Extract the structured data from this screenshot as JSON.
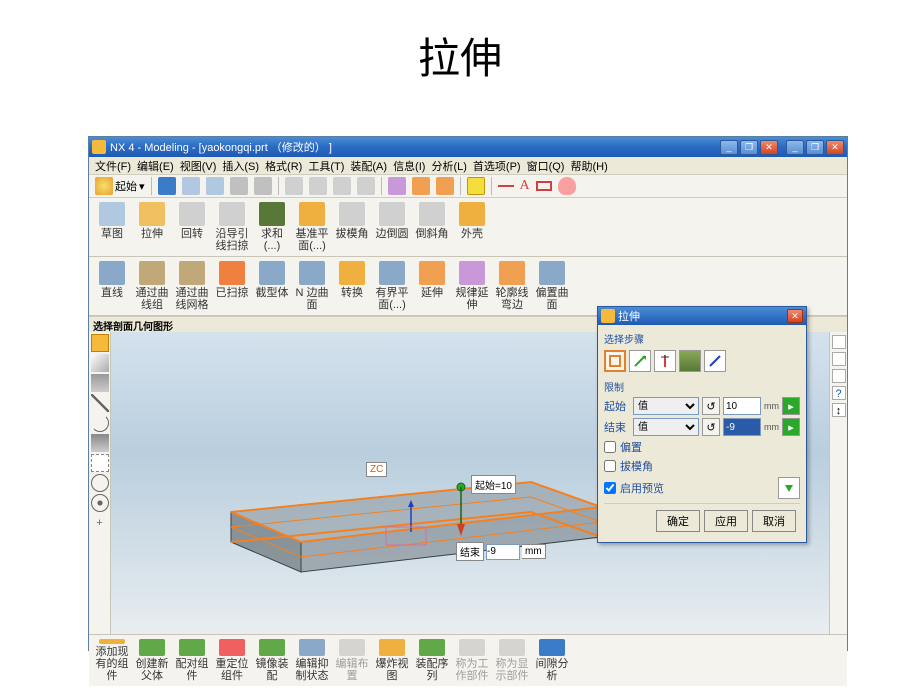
{
  "slide_title": "拉伸",
  "titlebar": {
    "text": "NX 4 - Modeling - [yaokongqi.prt （修改的） ]"
  },
  "winbuttons": {
    "min": "_",
    "restore": "❐",
    "close": "✕",
    "min2": "_",
    "restore2": "❐",
    "close2": "✕"
  },
  "menus": [
    "文件(F)",
    "编辑(E)",
    "视图(V)",
    "插入(S)",
    "格式(R)",
    "工具(T)",
    "装配(A)",
    "信息(I)",
    "分析(L)",
    "首选项(P)",
    "窗口(Q)",
    "帮助(H)"
  ],
  "dropdown1": {
    "label": "起始",
    "arrow": "▾"
  },
  "toolbar_icons": {
    "colors": [
      "#3a7cc8",
      "#3a7cc8",
      "#d0d0d0",
      "#d0d0d0",
      "#d0d0d0",
      "#d0d0d0"
    ]
  },
  "ribbon1": [
    {
      "label": "草图",
      "c": "#b0c8e0"
    },
    {
      "label": "拉伸",
      "c": "#f0c060"
    },
    {
      "label": "回转",
      "c": "#d0d0d0"
    },
    {
      "label": "沿导引线扫掠",
      "c": "#d0d0d0"
    },
    {
      "label": "求和(...)",
      "c": "#587838"
    },
    {
      "label": "基准平面(...)",
      "c": "#f0b040"
    },
    {
      "label": "拔模角",
      "c": "#d0d0d0"
    },
    {
      "label": "边倒圆",
      "c": "#d0d0d0"
    },
    {
      "label": "倒斜角",
      "c": "#d0d0d0"
    },
    {
      "label": "外壳",
      "c": "#f0b040"
    }
  ],
  "ribbon2": [
    {
      "label": "直线",
      "c": "#8aa8c8"
    },
    {
      "label": "通过曲线组",
      "c": "#c0a878"
    },
    {
      "label": "通过曲线网格",
      "c": "#c0a878"
    },
    {
      "label": "已扫掠",
      "c": "#f08040"
    },
    {
      "label": "截型体",
      "c": "#8aa8c8"
    },
    {
      "label": "N 边曲面",
      "c": "#8aa8c8"
    },
    {
      "label": "转换",
      "c": "#f0b040"
    },
    {
      "label": "有界平面(...)",
      "c": "#8aa8c8"
    },
    {
      "label": "延伸",
      "c": "#f0a050"
    },
    {
      "label": "规律延伸",
      "c": "#c898d8"
    },
    {
      "label": "轮廓线弯边",
      "c": "#f0a050"
    },
    {
      "label": "偏置曲面",
      "c": "#8aa8c8"
    }
  ],
  "status": "选择剖面几何图形",
  "dialog": {
    "title": "拉伸",
    "group1": "选择步骤",
    "group2": "限制",
    "start_label": "起始",
    "end_label": "结束",
    "value_opt": "值",
    "start_val": "10",
    "end_val": "-9",
    "unit": "mm",
    "offset": "偏置",
    "draft": "拔模角",
    "preview": "启用预览",
    "ok": "确定",
    "apply": "应用",
    "cancel": "取消"
  },
  "annotations": {
    "zc": "ZC",
    "start": "起始=10",
    "end_label": "结束",
    "end_val": "-9",
    "end_unit": "mm"
  },
  "bottom": [
    {
      "label": "添加现有的组件",
      "c": "#f0b040"
    },
    {
      "label": "创建新父体",
      "c": "#60a848"
    },
    {
      "label": "配对组件",
      "c": "#60a848"
    },
    {
      "label": "重定位组件",
      "c": "#f06060"
    },
    {
      "label": "镜像装配",
      "c": "#60a848"
    },
    {
      "label": "编辑抑制状态",
      "c": "#8aa8c8"
    },
    {
      "label": "编辑布置",
      "c": "#b0b0b0",
      "disabled": true
    },
    {
      "label": "爆炸视图",
      "c": "#f0b040"
    },
    {
      "label": "装配序列",
      "c": "#60a848"
    },
    {
      "label": "称为工作部件",
      "c": "#b0b0b0",
      "disabled": true
    },
    {
      "label": "称为显示部件",
      "c": "#b0b0b0",
      "disabled": true
    },
    {
      "label": "间隙分析",
      "c": "#3a7cc8"
    }
  ],
  "right_icons": {
    "q": "?",
    "arrows": "↕"
  }
}
